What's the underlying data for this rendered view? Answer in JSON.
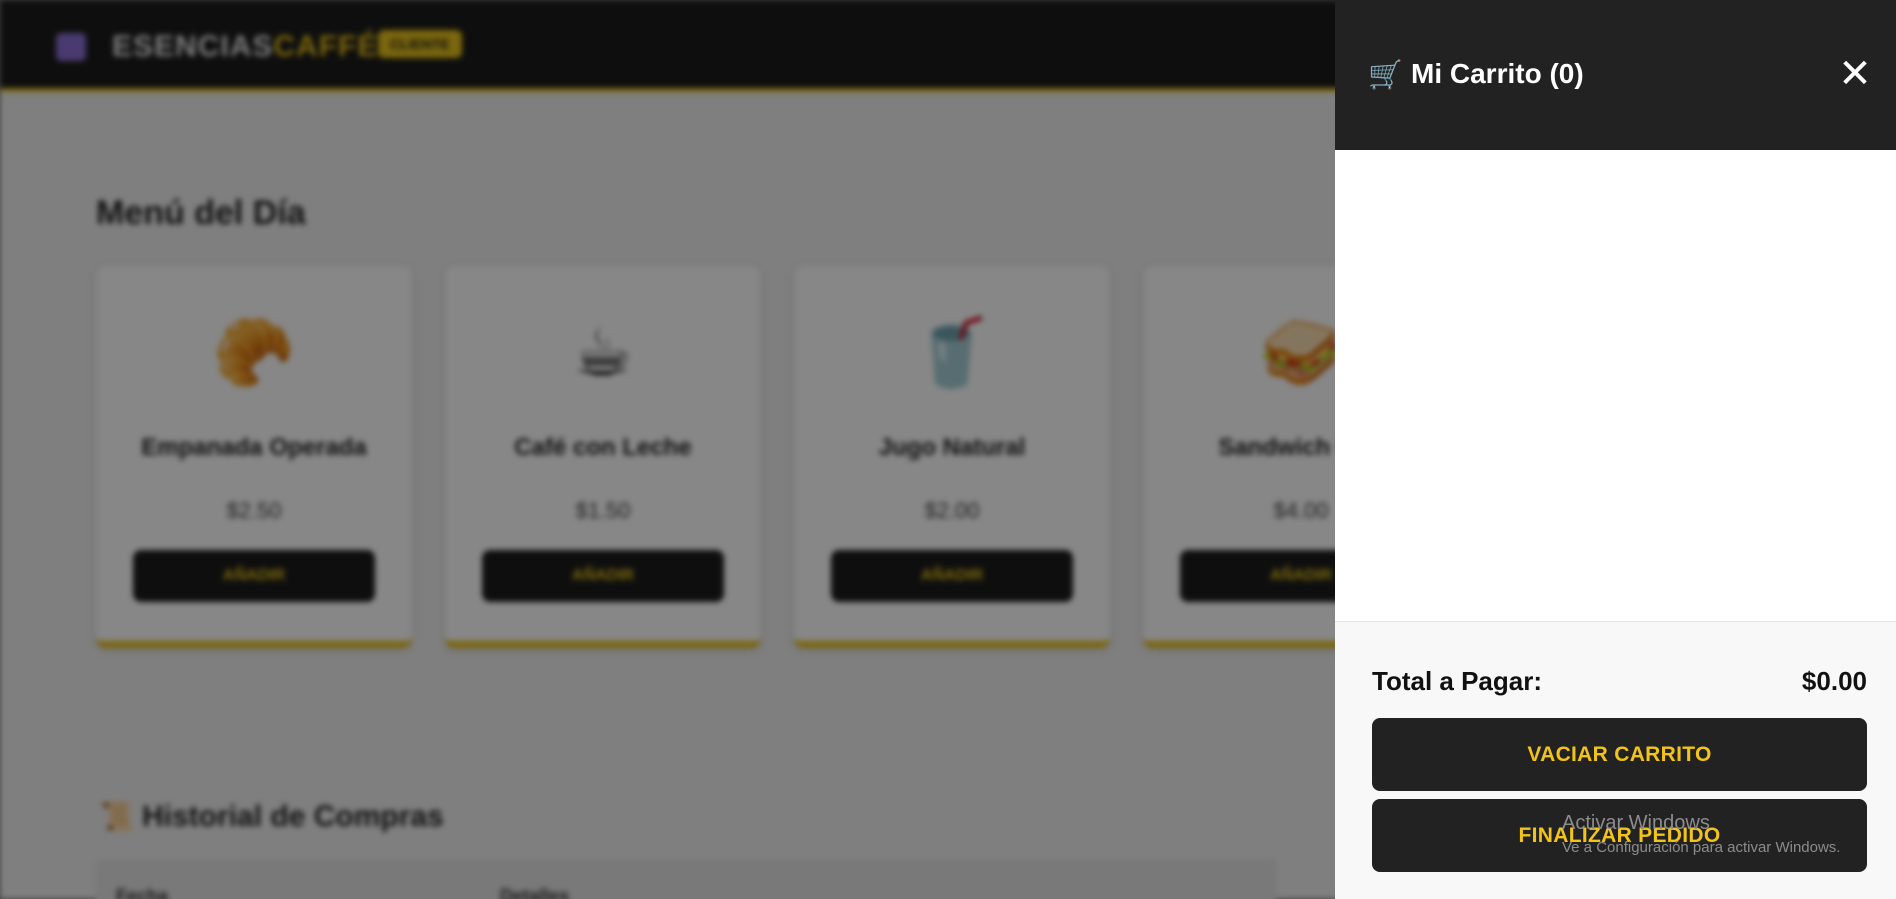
{
  "brand": {
    "name_main": "ESENCIAS",
    "name_accent": "CAFFÉ",
    "badge": "CLIENTE",
    "logo_icon": "store-icon"
  },
  "menu": {
    "title": "Menú del Día",
    "products": [
      {
        "name": "Empanada Operada",
        "price": "$2.50",
        "button": "AÑADIR",
        "icon": "🥐"
      },
      {
        "name": "Café con Leche",
        "price": "$1.50",
        "button": "AÑADIR",
        "icon": "☕"
      },
      {
        "name": "Jugo Natural",
        "price": "$2.00",
        "button": "AÑADIR",
        "icon": "🥤"
      },
      {
        "name": "Sandwich Gr...",
        "price": "$4.00",
        "button": "AÑADIR",
        "icon": "🥪"
      }
    ]
  },
  "history": {
    "icon": "📜",
    "title": "Historial de Compras",
    "columns": [
      "Fecha",
      "Detalles"
    ]
  },
  "cart": {
    "icon": "🛒",
    "title": "Mi Carrito (0)",
    "close": "✕",
    "total_label": "Total a Pagar:",
    "total_value": "$0.00",
    "empty_button": "VACIAR CARRITO",
    "finish_button": "FINALIZAR PEDIDO"
  },
  "windows_watermark": {
    "title": "Activar Windows",
    "subtitle": "Ve a Configuración para activar Windows."
  }
}
